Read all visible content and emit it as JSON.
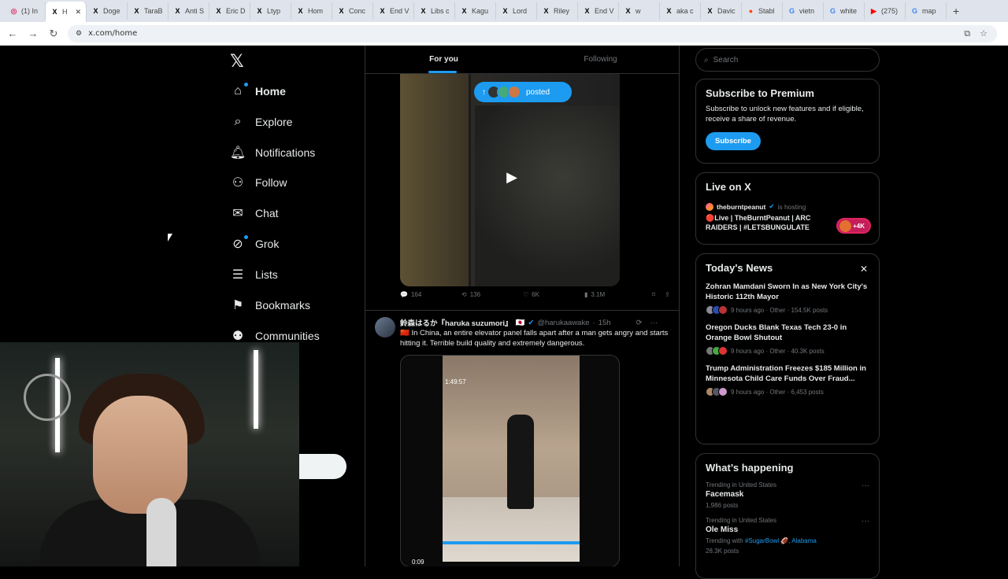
{
  "browser": {
    "tabs": [
      {
        "label": "(1) In",
        "icon": "instagram-icon",
        "color": "#e1306c"
      },
      {
        "label": "H",
        "icon": "x-icon",
        "active": true
      },
      {
        "label": "Doge",
        "icon": "x-icon"
      },
      {
        "label": "TaraB",
        "icon": "x-icon"
      },
      {
        "label": "Anti S",
        "icon": "x-icon"
      },
      {
        "label": "Eric D",
        "icon": "x-icon"
      },
      {
        "label": "Ltyp",
        "icon": "x-icon"
      },
      {
        "label": "Hom",
        "icon": "x-icon"
      },
      {
        "label": "Conc",
        "icon": "x-icon"
      },
      {
        "label": "End V",
        "icon": "x-icon"
      },
      {
        "label": "Libs c",
        "icon": "x-icon"
      },
      {
        "label": "Kagu",
        "icon": "x-icon"
      },
      {
        "label": "Lord",
        "icon": "x-icon"
      },
      {
        "label": "Riley",
        "icon": "x-icon"
      },
      {
        "label": "End V",
        "icon": "x-icon"
      },
      {
        "label": "w",
        "icon": "x-icon"
      },
      {
        "label": "aka c",
        "icon": "x-icon"
      },
      {
        "label": "Davic",
        "icon": "x-icon"
      },
      {
        "label": "Stabl",
        "icon": "reddit-icon",
        "color": "#ff4500"
      },
      {
        "label": "vietn",
        "icon": "google-icon",
        "color": "#4285f4"
      },
      {
        "label": "white",
        "icon": "google-icon",
        "color": "#4285f4"
      },
      {
        "label": "(275)",
        "icon": "youtube-icon",
        "color": "#ff0000"
      },
      {
        "label": "map",
        "icon": "google-icon",
        "color": "#4285f4"
      }
    ],
    "url": "x.com/home"
  },
  "nav": {
    "logo": "𝕏",
    "items": [
      {
        "label": "Home",
        "icon": "home-icon",
        "bold": true
      },
      {
        "label": "Explore",
        "icon": "search-icon"
      },
      {
        "label": "Notifications",
        "icon": "bell-icon"
      },
      {
        "label": "Follow",
        "icon": "follow-icon"
      },
      {
        "label": "Chat",
        "icon": "mail-icon"
      },
      {
        "label": "Grok",
        "icon": "grok-icon"
      },
      {
        "label": "Lists",
        "icon": "list-icon"
      },
      {
        "label": "Bookmarks",
        "icon": "bookmark-icon"
      },
      {
        "label": "Communities",
        "icon": "communities-icon"
      }
    ]
  },
  "feed": {
    "tabs": [
      "For you",
      "Following"
    ],
    "posted_label": "posted",
    "tweet1": {
      "replies": "164",
      "reposts": "136",
      "likes": "6K",
      "views": "3.1M"
    },
    "tweet2": {
      "name": "鈴森はるか『haruka suzumori』",
      "handle": "@harukaawake",
      "time": "15h",
      "text": "🇨🇳 In China, an entire elevator panel falls apart after a man gets angry and starts hitting it. Terrible build quality and extremely dangerous.",
      "video_timestamp": "1:49:57",
      "duration": "0:09"
    }
  },
  "right": {
    "search_placeholder": "Search",
    "premium": {
      "title": "Subscribe to Premium",
      "text": "Subscribe to unlock new features and if eligible, receive a share of revenue.",
      "button": "Subscribe"
    },
    "live": {
      "title": "Live on X",
      "host": "theburntpeanut",
      "host_suffix": "is hosting",
      "stream": "🔴Live | TheBurntPeanut | ARC RAIDERS | #LETSBUNGULATE",
      "count": "+4K"
    },
    "news": {
      "title": "Today's News",
      "items": [
        {
          "headline": "Zohran Mamdani Sworn In as New York City's Historic 112th Mayor",
          "meta": "9 hours ago · Other · 154.5K posts"
        },
        {
          "headline": "Oregon Ducks Blank Texas Tech 23-0 in Orange Bowl Shutout",
          "meta": "9 hours ago · Other · 40.3K posts"
        },
        {
          "headline": "Trump Administration Freezes $185 Million in Minnesota Child Care Funds Over Fraud...",
          "meta": "9 hours ago · Other · 6,453 posts"
        }
      ]
    },
    "happening": {
      "title": "What’s happening",
      "trends": [
        {
          "context": "Trending in United States",
          "name": "Facemask",
          "count": "1,986 posts"
        },
        {
          "context": "Trending in United States",
          "name": "Ole Miss",
          "with": "Trending with",
          "tags": "#SugarBowl 🏈, Alabama",
          "count": "28.3K posts"
        }
      ]
    }
  }
}
